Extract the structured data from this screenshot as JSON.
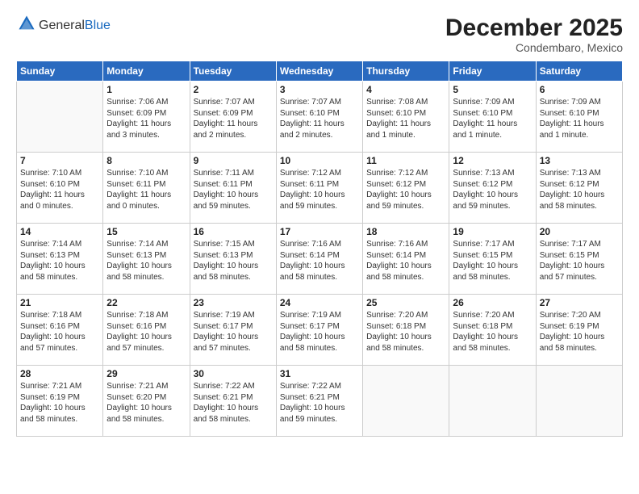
{
  "logo": {
    "general": "General",
    "blue": "Blue"
  },
  "title": "December 2025",
  "location": "Condembaro, Mexico",
  "days_header": [
    "Sunday",
    "Monday",
    "Tuesday",
    "Wednesday",
    "Thursday",
    "Friday",
    "Saturday"
  ],
  "weeks": [
    [
      {
        "day": "",
        "content": ""
      },
      {
        "day": "1",
        "content": "Sunrise: 7:06 AM\nSunset: 6:09 PM\nDaylight: 11 hours\nand 3 minutes."
      },
      {
        "day": "2",
        "content": "Sunrise: 7:07 AM\nSunset: 6:09 PM\nDaylight: 11 hours\nand 2 minutes."
      },
      {
        "day": "3",
        "content": "Sunrise: 7:07 AM\nSunset: 6:10 PM\nDaylight: 11 hours\nand 2 minutes."
      },
      {
        "day": "4",
        "content": "Sunrise: 7:08 AM\nSunset: 6:10 PM\nDaylight: 11 hours\nand 1 minute."
      },
      {
        "day": "5",
        "content": "Sunrise: 7:09 AM\nSunset: 6:10 PM\nDaylight: 11 hours\nand 1 minute."
      },
      {
        "day": "6",
        "content": "Sunrise: 7:09 AM\nSunset: 6:10 PM\nDaylight: 11 hours\nand 1 minute."
      }
    ],
    [
      {
        "day": "7",
        "content": "Sunrise: 7:10 AM\nSunset: 6:10 PM\nDaylight: 11 hours\nand 0 minutes."
      },
      {
        "day": "8",
        "content": "Sunrise: 7:10 AM\nSunset: 6:11 PM\nDaylight: 11 hours\nand 0 minutes."
      },
      {
        "day": "9",
        "content": "Sunrise: 7:11 AM\nSunset: 6:11 PM\nDaylight: 10 hours\nand 59 minutes."
      },
      {
        "day": "10",
        "content": "Sunrise: 7:12 AM\nSunset: 6:11 PM\nDaylight: 10 hours\nand 59 minutes."
      },
      {
        "day": "11",
        "content": "Sunrise: 7:12 AM\nSunset: 6:12 PM\nDaylight: 10 hours\nand 59 minutes."
      },
      {
        "day": "12",
        "content": "Sunrise: 7:13 AM\nSunset: 6:12 PM\nDaylight: 10 hours\nand 59 minutes."
      },
      {
        "day": "13",
        "content": "Sunrise: 7:13 AM\nSunset: 6:12 PM\nDaylight: 10 hours\nand 58 minutes."
      }
    ],
    [
      {
        "day": "14",
        "content": "Sunrise: 7:14 AM\nSunset: 6:13 PM\nDaylight: 10 hours\nand 58 minutes."
      },
      {
        "day": "15",
        "content": "Sunrise: 7:14 AM\nSunset: 6:13 PM\nDaylight: 10 hours\nand 58 minutes."
      },
      {
        "day": "16",
        "content": "Sunrise: 7:15 AM\nSunset: 6:13 PM\nDaylight: 10 hours\nand 58 minutes."
      },
      {
        "day": "17",
        "content": "Sunrise: 7:16 AM\nSunset: 6:14 PM\nDaylight: 10 hours\nand 58 minutes."
      },
      {
        "day": "18",
        "content": "Sunrise: 7:16 AM\nSunset: 6:14 PM\nDaylight: 10 hours\nand 58 minutes."
      },
      {
        "day": "19",
        "content": "Sunrise: 7:17 AM\nSunset: 6:15 PM\nDaylight: 10 hours\nand 58 minutes."
      },
      {
        "day": "20",
        "content": "Sunrise: 7:17 AM\nSunset: 6:15 PM\nDaylight: 10 hours\nand 57 minutes."
      }
    ],
    [
      {
        "day": "21",
        "content": "Sunrise: 7:18 AM\nSunset: 6:16 PM\nDaylight: 10 hours\nand 57 minutes."
      },
      {
        "day": "22",
        "content": "Sunrise: 7:18 AM\nSunset: 6:16 PM\nDaylight: 10 hours\nand 57 minutes."
      },
      {
        "day": "23",
        "content": "Sunrise: 7:19 AM\nSunset: 6:17 PM\nDaylight: 10 hours\nand 57 minutes."
      },
      {
        "day": "24",
        "content": "Sunrise: 7:19 AM\nSunset: 6:17 PM\nDaylight: 10 hours\nand 58 minutes."
      },
      {
        "day": "25",
        "content": "Sunrise: 7:20 AM\nSunset: 6:18 PM\nDaylight: 10 hours\nand 58 minutes."
      },
      {
        "day": "26",
        "content": "Sunrise: 7:20 AM\nSunset: 6:18 PM\nDaylight: 10 hours\nand 58 minutes."
      },
      {
        "day": "27",
        "content": "Sunrise: 7:20 AM\nSunset: 6:19 PM\nDaylight: 10 hours\nand 58 minutes."
      }
    ],
    [
      {
        "day": "28",
        "content": "Sunrise: 7:21 AM\nSunset: 6:19 PM\nDaylight: 10 hours\nand 58 minutes."
      },
      {
        "day": "29",
        "content": "Sunrise: 7:21 AM\nSunset: 6:20 PM\nDaylight: 10 hours\nand 58 minutes."
      },
      {
        "day": "30",
        "content": "Sunrise: 7:22 AM\nSunset: 6:21 PM\nDaylight: 10 hours\nand 58 minutes."
      },
      {
        "day": "31",
        "content": "Sunrise: 7:22 AM\nSunset: 6:21 PM\nDaylight: 10 hours\nand 59 minutes."
      },
      {
        "day": "",
        "content": ""
      },
      {
        "day": "",
        "content": ""
      },
      {
        "day": "",
        "content": ""
      }
    ]
  ]
}
